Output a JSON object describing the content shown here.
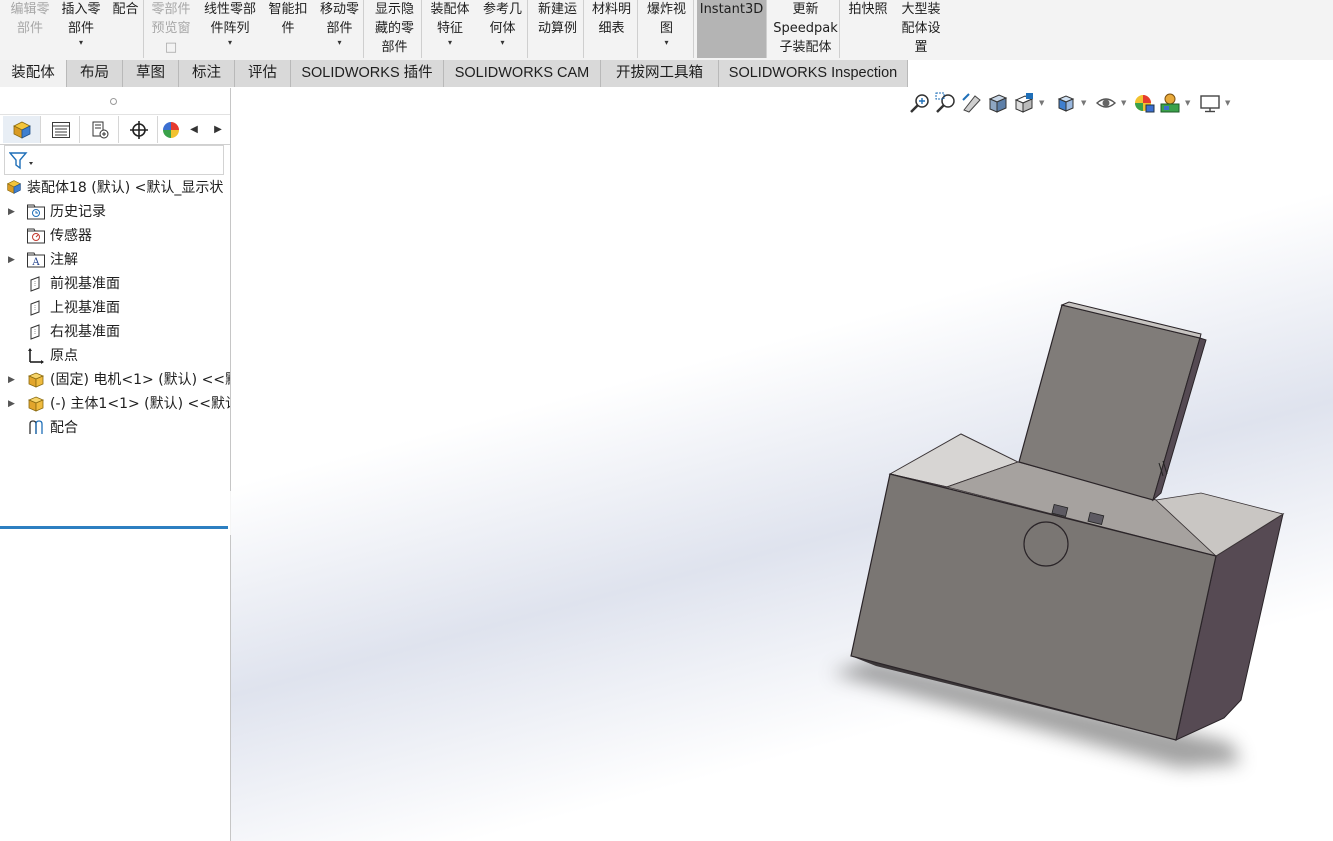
{
  "ribbon": {
    "items": [
      {
        "lines": [
          "编辑零",
          "部件"
        ],
        "disabled": true
      },
      {
        "lines": [
          "插入零",
          "部件"
        ],
        "dropdown": true
      },
      {
        "lines": [
          "配合"
        ]
      },
      {
        "lines": [
          "零部件",
          "预览窗",
          "□"
        ],
        "disabled": true
      },
      {
        "lines": [
          "线性零部",
          "件阵列"
        ],
        "dropdown": true
      },
      {
        "lines": [
          "智能扣",
          "件"
        ]
      },
      {
        "lines": [
          "移动零",
          "部件"
        ],
        "dropdown": true
      },
      {
        "lines": [
          "显示隐",
          "藏的零",
          "部件"
        ]
      },
      {
        "lines": [
          "装配体",
          "特征"
        ],
        "dropdown": true
      },
      {
        "lines": [
          "参考几",
          "何体"
        ],
        "dropdown": true
      },
      {
        "lines": [
          "新建运",
          "动算例"
        ]
      },
      {
        "lines": [
          "材料明",
          "细表"
        ]
      },
      {
        "lines": [
          "爆炸视",
          "图"
        ],
        "dropdown": true
      },
      {
        "lines": [
          "Instant3D"
        ],
        "active": true
      },
      {
        "lines": [
          "更新",
          "Speedpak",
          "子装配体"
        ]
      },
      {
        "lines": [
          "拍快照"
        ]
      },
      {
        "lines": [
          "大型装",
          "配体设",
          "置"
        ]
      }
    ]
  },
  "tabs": [
    {
      "label": "装配体",
      "selected": true
    },
    {
      "label": "布局"
    },
    {
      "label": "草图"
    },
    {
      "label": "标注"
    },
    {
      "label": "评估"
    },
    {
      "label": "SOLIDWORKS 插件"
    },
    {
      "label": "SOLIDWORKS CAM"
    },
    {
      "label": "开拔网工具箱"
    },
    {
      "label": "SOLIDWORKS Inspection"
    }
  ],
  "tree": {
    "root": "装配体18 (默认) <默认_显示状",
    "items": [
      {
        "label": "历史记录",
        "icon": "history-folder-icon",
        "expandable": true
      },
      {
        "label": "传感器",
        "icon": "sensor-folder-icon",
        "expandable": false
      },
      {
        "label": "注解",
        "icon": "annotation-folder-icon",
        "expandable": true
      },
      {
        "label": "前视基准面",
        "icon": "plane-icon",
        "expandable": false
      },
      {
        "label": "上视基准面",
        "icon": "plane-icon",
        "expandable": false
      },
      {
        "label": "右视基准面",
        "icon": "plane-icon",
        "expandable": false
      },
      {
        "label": "原点",
        "icon": "origin-icon",
        "expandable": false
      },
      {
        "label": "(固定) 电机<1> (默认) <<默",
        "icon": "part-icon",
        "expandable": true
      },
      {
        "label": "(-) 主体1<1> (默认) <<默认",
        "icon": "part-icon",
        "expandable": true
      },
      {
        "label": "配合",
        "icon": "mates-icon",
        "expandable": false
      }
    ]
  },
  "colors": {
    "accent": "#2d7fc1",
    "model_front": "#7a7673",
    "model_side": "#554a52",
    "model_top": "#a9a5a2"
  }
}
